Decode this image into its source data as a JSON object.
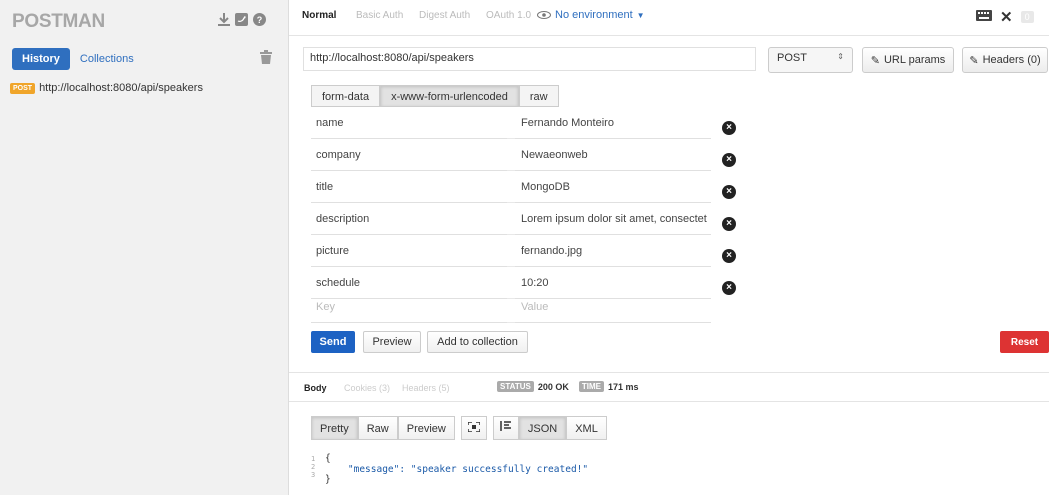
{
  "sidebar": {
    "logo": "POSTMAN",
    "tabs": [
      {
        "label": "History"
      },
      {
        "label": "Collections"
      }
    ],
    "history": [
      {
        "method": "POST",
        "url": "http://localhost:8080/api/speakers"
      }
    ],
    "icons": [
      "download-icon",
      "twitter-icon",
      "help-icon",
      "trash-icon"
    ]
  },
  "topbar": {
    "tabs": [
      {
        "label": "Normal"
      },
      {
        "label": "Basic Auth"
      },
      {
        "label": "Digest Auth"
      },
      {
        "label": "OAuth 1.0"
      }
    ],
    "environment": "No environment",
    "badge_count": "0"
  },
  "request": {
    "url": "http://localhost:8080/api/speakers",
    "method": "POST",
    "url_params_label": "URL params",
    "headers_label": "Headers (0)"
  },
  "body_tabs": [
    {
      "label": "form-data"
    },
    {
      "label": "x-www-form-urlencoded"
    },
    {
      "label": "raw"
    }
  ],
  "fields": [
    {
      "key": "name",
      "value": "Fernando Monteiro"
    },
    {
      "key": "company",
      "value": "Newaeonweb"
    },
    {
      "key": "title",
      "value": "MongoDB"
    },
    {
      "key": "description",
      "value": "Lorem ipsum dolor sit amet, consectet"
    },
    {
      "key": "picture",
      "value": "fernando.jpg"
    },
    {
      "key": "schedule",
      "value": "10:20"
    }
  ],
  "placeholder": {
    "key": "Key",
    "value": "Value"
  },
  "actions": {
    "send": "Send",
    "preview": "Preview",
    "add": "Add to collection",
    "reset": "Reset"
  },
  "response": {
    "tabs": [
      {
        "label": "Body"
      },
      {
        "label": "Cookies (3)"
      },
      {
        "label": "Headers (5)"
      }
    ],
    "status_label": "STATUS",
    "status_value": "200 OK",
    "time_label": "TIME",
    "time_value": "171 ms",
    "view_buttons": [
      "Pretty",
      "Raw",
      "Preview"
    ],
    "format_buttons": [
      "JSON",
      "XML"
    ],
    "code_lines": [
      {
        "num": "1",
        "text": "{"
      },
      {
        "num": "2",
        "text": "    \"message\": \"speaker successfully created!\""
      },
      {
        "num": "3",
        "text": "}"
      }
    ]
  },
  "colors": {
    "accent": "#2f6fbf",
    "send": "#1d62c3",
    "reset": "#dd3333",
    "post_badge": "#f0a52a"
  }
}
